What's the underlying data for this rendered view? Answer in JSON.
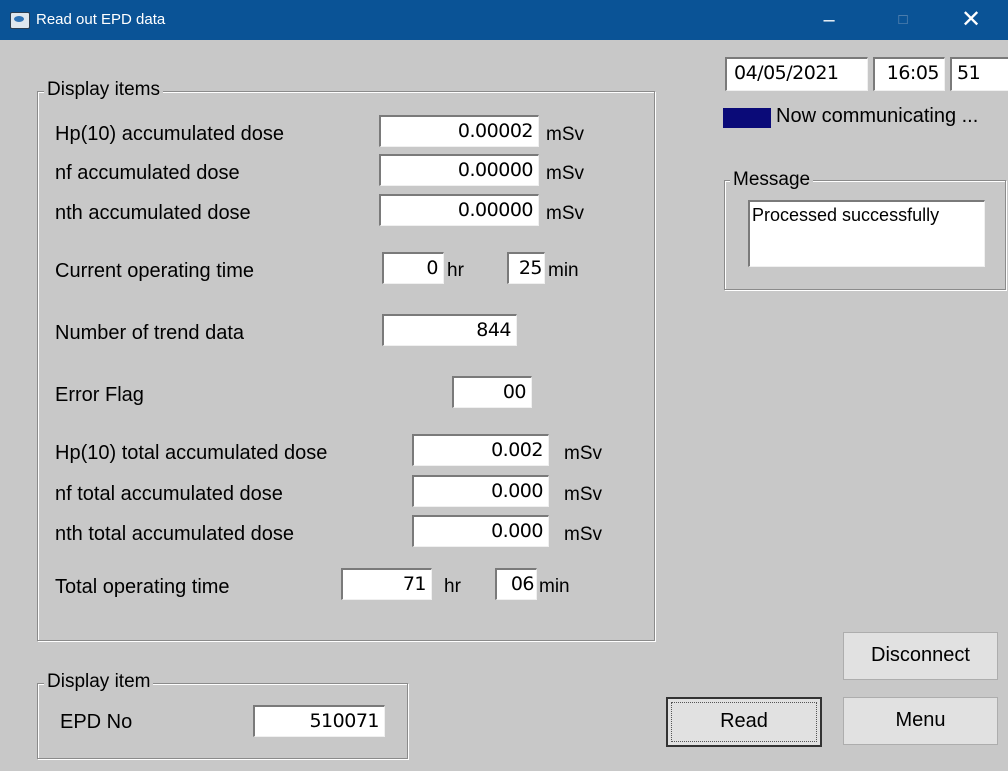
{
  "window": {
    "title": "Read out EPD data",
    "minimize": "–",
    "maximize": "□",
    "close": "✕"
  },
  "status": {
    "date": "04/05/2021",
    "time": "16:05",
    "seconds": "51",
    "communicating": "Now communicating ...",
    "indicator_color": "#0a0a78"
  },
  "message": {
    "label": "Message",
    "text": "Processed successfully"
  },
  "display_items": {
    "label": "Display items",
    "hp10_label": "Hp(10) accumulated dose",
    "hp10_value": "0.00002",
    "hp10_unit": "mSv",
    "nf_label": "nf accumulated dose",
    "nf_value": "0.00000",
    "nf_unit": "mSv",
    "nth_label": "nth accumulated dose",
    "nth_value": "0.00000",
    "nth_unit": "mSv",
    "cur_op_label": "Current operating time",
    "cur_op_hr": "0",
    "cur_op_hr_unit": "hr",
    "cur_op_min": "25",
    "cur_op_min_unit": "min",
    "trend_label": "Number of trend data",
    "trend_value": "844",
    "error_label": "Error Flag",
    "error_value": "00",
    "hp10_total_label": "Hp(10) total accumulated dose",
    "hp10_total_value": "0.002",
    "hp10_total_unit": "mSv",
    "nf_total_label": "nf total accumulated dose",
    "nf_total_value": "0.000",
    "nf_total_unit": "mSv",
    "nth_total_label": "nth total accumulated dose",
    "nth_total_value": "0.000",
    "nth_total_unit": "mSv",
    "total_op_label": "Total operating time",
    "total_op_hr": "71",
    "total_op_hr_unit": "hr",
    "total_op_min": "06",
    "total_op_min_unit": "min"
  },
  "display_item": {
    "label": "Display item",
    "epd_label": "EPD No",
    "epd_value": "510071"
  },
  "buttons": {
    "disconnect": "Disconnect",
    "read": "Read",
    "menu": "Menu"
  }
}
